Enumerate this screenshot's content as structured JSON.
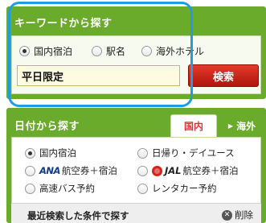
{
  "keyword_panel": {
    "title": "キーワードから探す",
    "options": [
      {
        "label": "国内宿泊",
        "checked": true
      },
      {
        "label": "駅名",
        "checked": false
      },
      {
        "label": "海外ホテル",
        "checked": false
      }
    ],
    "input_value": "平日限定",
    "search_button": "検索"
  },
  "date_panel": {
    "title": "日付から探す",
    "tabs": {
      "domestic": "国内",
      "overseas": "海外"
    },
    "options": {
      "domestic_stay": "国内宿泊",
      "day_trip": "日帰り・デイユース",
      "ana_brand": "ANA",
      "ana_label": "航空券＋宿泊",
      "jal_brand": "JAL",
      "jal_label": "航空券＋宿泊",
      "bus": "高速バス予約",
      "rental_car": "レンタカー予約"
    },
    "recent_title": "最近検索した条件で探す",
    "delete_label": "削除"
  },
  "colors": {
    "panel_green": "#6aab2b",
    "search_red": "#c8261a",
    "highlight_blue": "#1e9de3"
  }
}
